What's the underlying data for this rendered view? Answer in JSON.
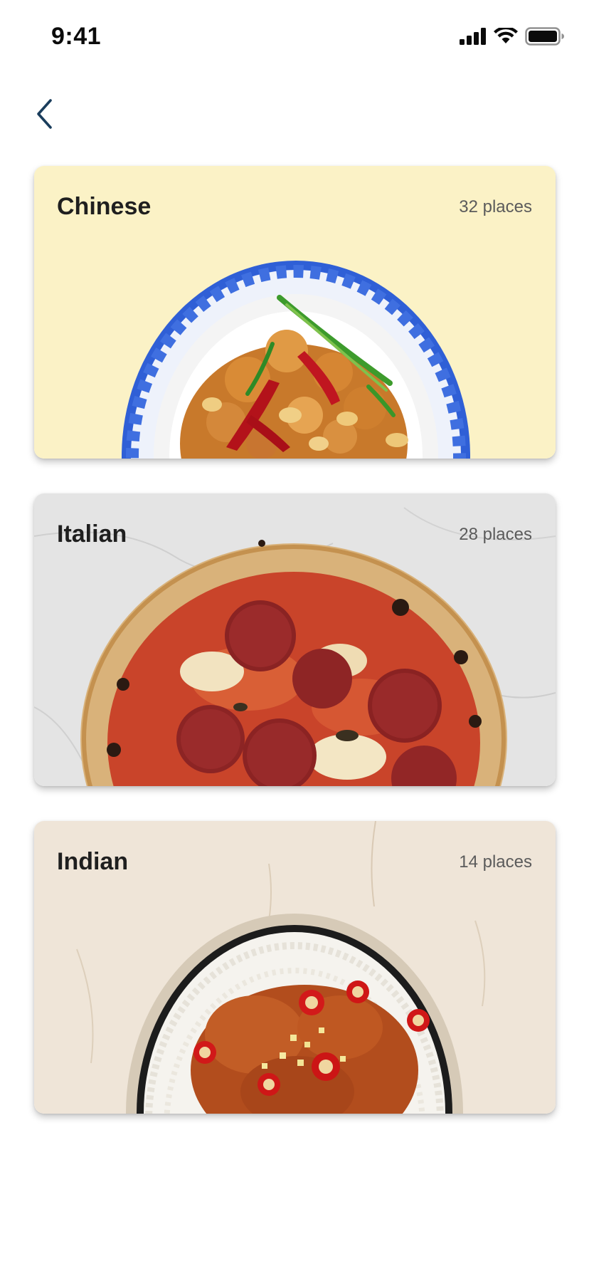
{
  "status_bar": {
    "time": "9:41",
    "icons": [
      "signal-icon",
      "wifi-icon",
      "battery-icon"
    ]
  },
  "navigation": {
    "back_icon": "chevron-left-icon",
    "accent_color": "#1a3d5c"
  },
  "categories": [
    {
      "name": "Chinese",
      "count": "32 places",
      "background_color": "#fbf2c6",
      "image": "chinese-dish-image"
    },
    {
      "name": "Italian",
      "count": "28 places",
      "background_color": "#e4e4e4",
      "image": "italian-pizza-image"
    },
    {
      "name": "Indian",
      "count": "14 places",
      "background_color": "#efe5d8",
      "image": "indian-curry-image"
    }
  ]
}
